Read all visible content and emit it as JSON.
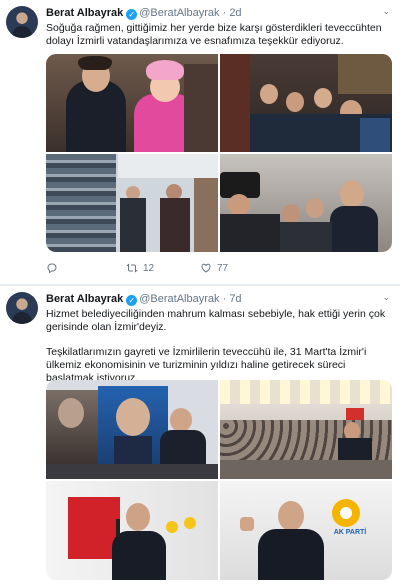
{
  "tweets": [
    {
      "author": "Berat Albayrak",
      "handle": "@BeratAlbayrak",
      "time": "2d",
      "text": "Soğuğa rağmen, gittiğimiz her yerde bize karşı gösterdikleri teveccühten dolayı İzmirli vatandaşlarımıza ve esnafımıza teşekkür ediyoruz.",
      "replies": "",
      "retweets": "12",
      "likes": "77"
    },
    {
      "author": "Berat Albayrak",
      "handle": "@BeratAlbayrak",
      "time": "7d",
      "text_p1": "Hizmet belediyeciliğinden mahrum kalması sebebiyle, hak ettiği yerin çok gerisinde olan İzmir'deyiz.",
      "text_p2": "Teşkilatlarımızın gayreti ve İzmirlilerin teveccühü ile, 31 Mart'ta İzmir'i ülkemiz ekonomisinin ve turizminin yıldızı haline getirecek süreci başlatmak istiyoruz.",
      "banner_text": "AK PARTİ"
    }
  ],
  "icons": {
    "verified": "verified-badge-icon",
    "chevron": "chevron-down-icon",
    "reply": "reply-icon",
    "retweet": "retweet-icon",
    "like": "heart-icon"
  },
  "colors": {
    "verified": "#1da1f2",
    "muted": "#657786",
    "divider": "#e6ecf0"
  }
}
